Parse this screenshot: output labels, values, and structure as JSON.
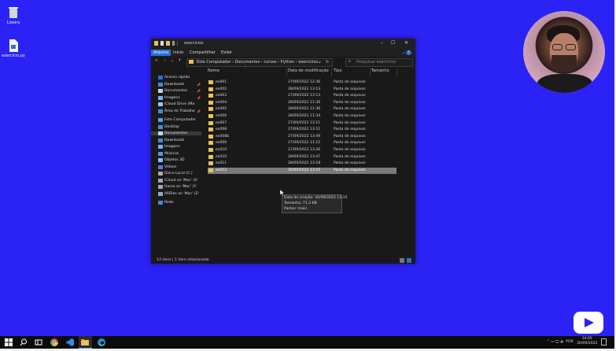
{
  "desktop": {
    "icons": [
      {
        "label": "Lixeira",
        "icon": "recycle-bin-icon"
      },
      {
        "label": "exercicio.py",
        "icon": "python-file-icon"
      }
    ]
  },
  "window": {
    "title": "exercicios",
    "controls": {
      "minimize": "–",
      "maximize": "☐",
      "close": "✕"
    },
    "ribbon": {
      "tabs": [
        "Arquivo",
        "Início",
        "Compartilhar",
        "Exibir"
      ],
      "active": "Arquivo",
      "expand": "⌄",
      "help": "?"
    },
    "address": {
      "back": "←",
      "forward": "→",
      "recent": "⌄",
      "up": "↑",
      "path": "Este Computador  ›  Documentos  ›  cursos  ›  Python  ›  exercicios  ›",
      "refresh": "↻"
    },
    "search": {
      "placeholder": "Pesquisar exercícios"
    },
    "nav": {
      "items": [
        {
          "label": "Acesso rápido",
          "icon": "star-icon",
          "pinned": false
        },
        {
          "label": "Downloads",
          "icon": "download-icon",
          "pinned": true
        },
        {
          "label": "Documentos",
          "icon": "documents-icon",
          "pinned": true
        },
        {
          "label": "Imagens",
          "icon": "images-icon",
          "pinned": true
        },
        {
          "label": "iCloud Drive (Ma",
          "icon": "cloud-icon",
          "pinned": false
        },
        {
          "label": "Área de Trabalho",
          "icon": "desktop-icon",
          "pinned": true
        },
        {
          "label": "Este Computador",
          "icon": "computer-icon",
          "pinned": false
        },
        {
          "label": "Desktop",
          "icon": "desktop-icon",
          "pinned": false
        },
        {
          "label": "Documentos",
          "icon": "documents-icon",
          "pinned": false
        },
        {
          "label": "Downloads",
          "icon": "download-icon",
          "pinned": false
        },
        {
          "label": "Imagens",
          "icon": "images-icon",
          "pinned": false
        },
        {
          "label": "Músicas",
          "icon": "music-icon",
          "pinned": false
        },
        {
          "label": "Objetos 3D",
          "icon": "cube-icon",
          "pinned": false
        },
        {
          "label": "Vídeos",
          "icon": "video-icon",
          "pinned": false
        },
        {
          "label": "Disco Local (C:)",
          "icon": "drive-icon",
          "pinned": false
        },
        {
          "label": "iCloud on 'Mac' (X:",
          "icon": "network-drive-icon",
          "pinned": false
        },
        {
          "label": "Home on 'Mac' (Y:",
          "icon": "network-drive-icon",
          "pinned": false
        },
        {
          "label": "AllFiles on 'Mac' (Z:",
          "icon": "network-drive-icon",
          "pinned": false
        },
        {
          "label": "Rede",
          "icon": "network-icon",
          "pinned": false
        }
      ],
      "pin_glyph": "📌",
      "selected_index": 8
    },
    "columns": {
      "name": "Nome",
      "date": "Data de modificação",
      "type": "Tipo",
      "size": "Tamanho"
    },
    "files": [
      {
        "name": "ex001",
        "date": "27/09/2022 12:36",
        "type": "Pasta de arquivos"
      },
      {
        "name": "ex002",
        "date": "28/09/2022 13:13",
        "type": "Pasta de arquivos"
      },
      {
        "name": "ex003",
        "date": "27/09/2022 13:13",
        "type": "Pasta de arquivos"
      },
      {
        "name": "ex004",
        "date": "28/09/2022 11:36",
        "type": "Pasta de arquivos"
      },
      {
        "name": "ex005",
        "date": "28/09/2022 11:36",
        "type": "Pasta de arquivos"
      },
      {
        "name": "ex006",
        "date": "28/09/2022 11:34",
        "type": "Pasta de arquivos"
      },
      {
        "name": "ex007",
        "date": "27/09/2022 13:11",
        "type": "Pasta de arquivos"
      },
      {
        "name": "ex008",
        "date": "27/09/2022 13:11",
        "type": "Pasta de arquivos"
      },
      {
        "name": "ex008b",
        "date": "27/09/2022 13:49",
        "type": "Pasta de arquivos"
      },
      {
        "name": "ex009",
        "date": "27/09/2022 11:15",
        "type": "Pasta de arquivos"
      },
      {
        "name": "ex010",
        "date": "27/09/2022 13:26",
        "type": "Pasta de arquivos"
      },
      {
        "name": "ex010",
        "date": "28/09/2022 13:47",
        "type": "Pasta de arquivos"
      },
      {
        "name": "ex011",
        "date": "28/09/2022 13:18",
        "type": "Pasta de arquivos"
      },
      {
        "name": "ex012",
        "date": "30/09/2022 13:15",
        "type": "Pasta de arquivos"
      }
    ],
    "selected_file_index": 13,
    "tooltip": {
      "line1": "Data de criação: 30/09/2022 13:15",
      "line2": "Tamanho: 71,3 KB",
      "line3": "Pastas: main"
    },
    "status": "13 itens   |   1 item selecionado"
  },
  "taskbar": {
    "apps": [
      "windows-start-icon",
      "search-icon",
      "task-view-icon",
      "chrome-icon",
      "vscode-icon",
      "file-explorer-icon",
      "edge-icon"
    ],
    "tray": "⌃ ▭ 🖵 🔈 POR",
    "time": "14:05",
    "date": "30/09/2022"
  },
  "colors": {
    "desktop": "#2b22f5",
    "window": "#191919",
    "accent": "#2a6fd6",
    "folder": "#e8c15a"
  }
}
